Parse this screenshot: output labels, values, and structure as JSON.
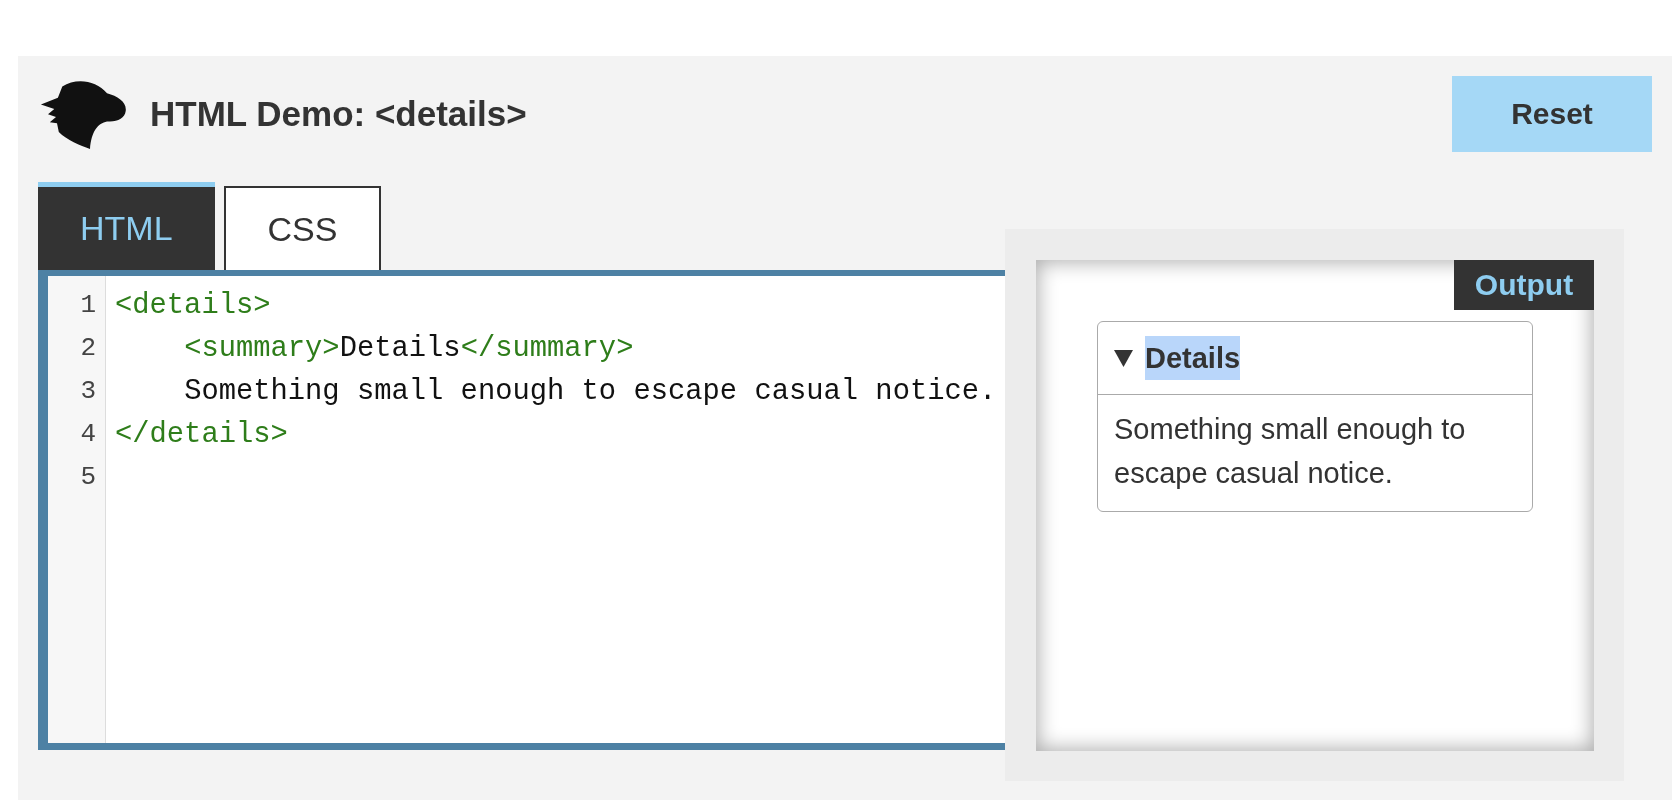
{
  "header": {
    "title": "HTML Demo: <details>",
    "reset_button": "Reset"
  },
  "tabs": [
    {
      "label": "HTML",
      "selected": true
    },
    {
      "label": "CSS",
      "selected": false
    }
  ],
  "editor": {
    "lines": [
      {
        "number": "1",
        "tokens": [
          {
            "kind": "tag",
            "text": "<details>"
          }
        ]
      },
      {
        "number": "2",
        "tokens": [
          {
            "kind": "tag",
            "text": "    <summary>"
          },
          {
            "kind": "text",
            "text": "Details"
          },
          {
            "kind": "tag",
            "text": "</summary>"
          }
        ]
      },
      {
        "number": "3",
        "tokens": [
          {
            "kind": "text",
            "text": "    Something small enough to escape casual notice."
          }
        ]
      },
      {
        "number": "4",
        "tokens": [
          {
            "kind": "tag",
            "text": "</details>"
          }
        ]
      },
      {
        "number": "5"
      }
    ]
  },
  "output": {
    "label": "Output",
    "details": {
      "open": true,
      "summary": "Details",
      "summary_highlighted": true,
      "content": "Something small enough to escape casual notice."
    }
  }
}
